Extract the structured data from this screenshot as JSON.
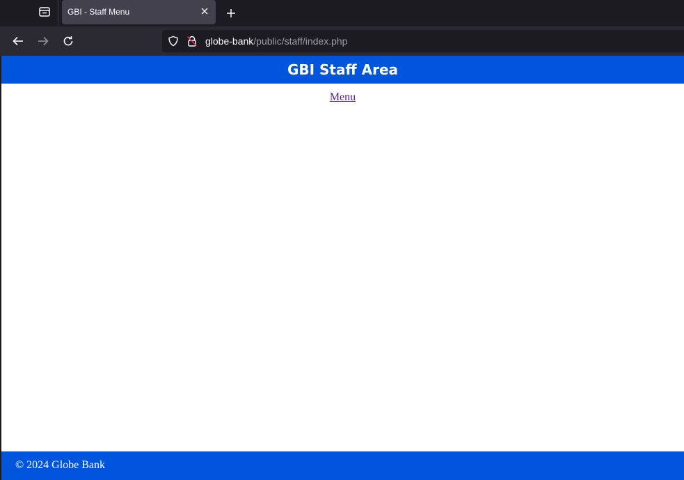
{
  "browser": {
    "tab": {
      "title": "GBI - Staff Menu"
    },
    "url": {
      "host": "globe-bank",
      "path": "/public/staff/index.php"
    },
    "icons": {
      "tab_overview": "tab-overview-icon",
      "close": "close-icon",
      "new_tab": "plus-icon",
      "back": "back-arrow-icon",
      "forward": "forward-arrow-icon",
      "reload": "reload-icon",
      "shield": "shield-icon",
      "insecure": "insecure-lock-icon"
    }
  },
  "page": {
    "header_title": "GBI Staff Area",
    "menu_link": "Menu",
    "footer_text": "© 2024 Globe Bank"
  },
  "colors": {
    "brand_blue": "#0055dd",
    "link_visited": "#551a8b",
    "insecure_red": "#e22850"
  }
}
